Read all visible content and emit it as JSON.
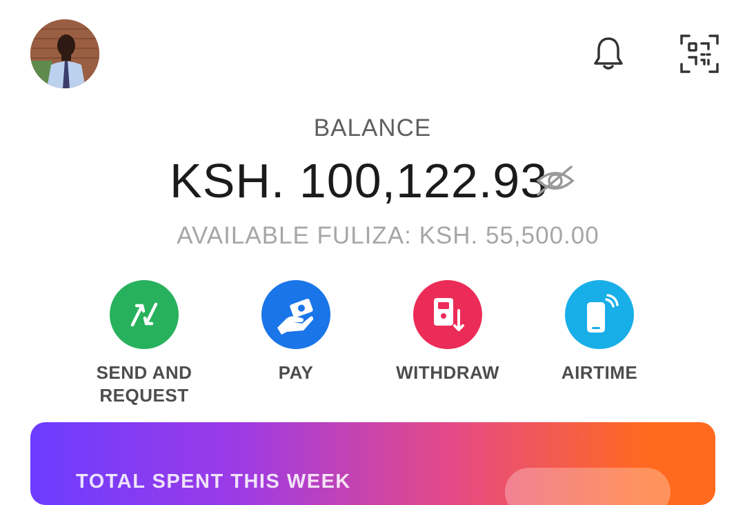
{
  "header": {
    "avatar_icon": "user-avatar",
    "notification_icon": "bell-icon",
    "qr_icon": "qr-scan-icon"
  },
  "balance": {
    "label": "BALANCE",
    "amount": "KSH. 100,122.93",
    "visibility_icon": "eye-off-icon",
    "fuliza": "AVAILABLE FULIZA: KSH. 55,500.00"
  },
  "actions": [
    {
      "label": "SEND AND\nREQUEST",
      "color": "#27b15c",
      "icon": "swap-arrows-icon"
    },
    {
      "label": "PAY",
      "color": "#1a75e8",
      "icon": "hand-money-icon"
    },
    {
      "label": "WITHDRAW",
      "color": "#ec2c58",
      "icon": "phone-cash-out-icon"
    },
    {
      "label": "AIRTIME",
      "color": "#18aee8",
      "icon": "phone-signal-icon"
    }
  ],
  "weekly_card": {
    "title": "TOTAL SPENT THIS WEEK"
  }
}
